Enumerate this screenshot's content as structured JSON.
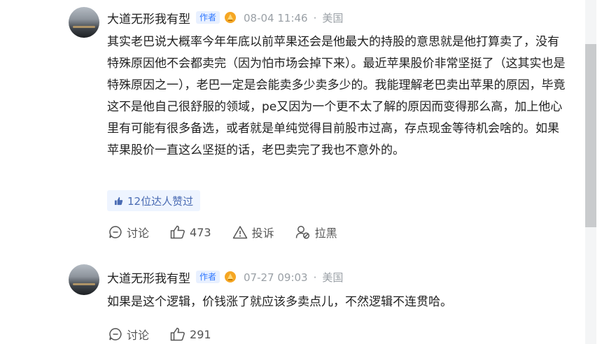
{
  "comments": [
    {
      "author": "大道无形我有型",
      "role_tag": "作者",
      "date": "08-04 11:46",
      "separator": "·",
      "location": "美国",
      "text": "其实老巴说大概率今年年底以前苹果还会是他最大的持股的意思就是他打算卖了，没有特殊原因他不会都卖完（因为怕市场会掉下来）。最近苹果股价非常坚挺了（这其实也是特殊原因之一），老巴一定是会能卖多少卖多少的。我能理解老巴卖出苹果的原因，毕竟这不是他自己很舒服的领域，pe又因为一个更不太了解的原因而变得那么高，加上他心里有可能有很多备选，或者就是单纯觉得目前股市过高，存点现金等待机会啥的。如果苹果股价一直这么坚挺的话，老巴卖完了我也不意外的。",
      "expert_likes": "12位达人赞过",
      "discuss_label": "讨论",
      "like_count": "473",
      "report_label": "投诉",
      "block_label": "拉黑"
    },
    {
      "author": "大道无形我有型",
      "role_tag": "作者",
      "date": "07-27 09:03",
      "separator": "·",
      "location": "美国",
      "text": "如果是这个逻辑，价钱涨了就应该多卖点儿，不然逻辑不连贯哈。",
      "discuss_label": "讨论",
      "like_count": "291"
    }
  ],
  "colors": {
    "tag_blue": "#2f77ff",
    "meta_gray": "#9aa0a6",
    "badge_gold": "#f5a623"
  }
}
